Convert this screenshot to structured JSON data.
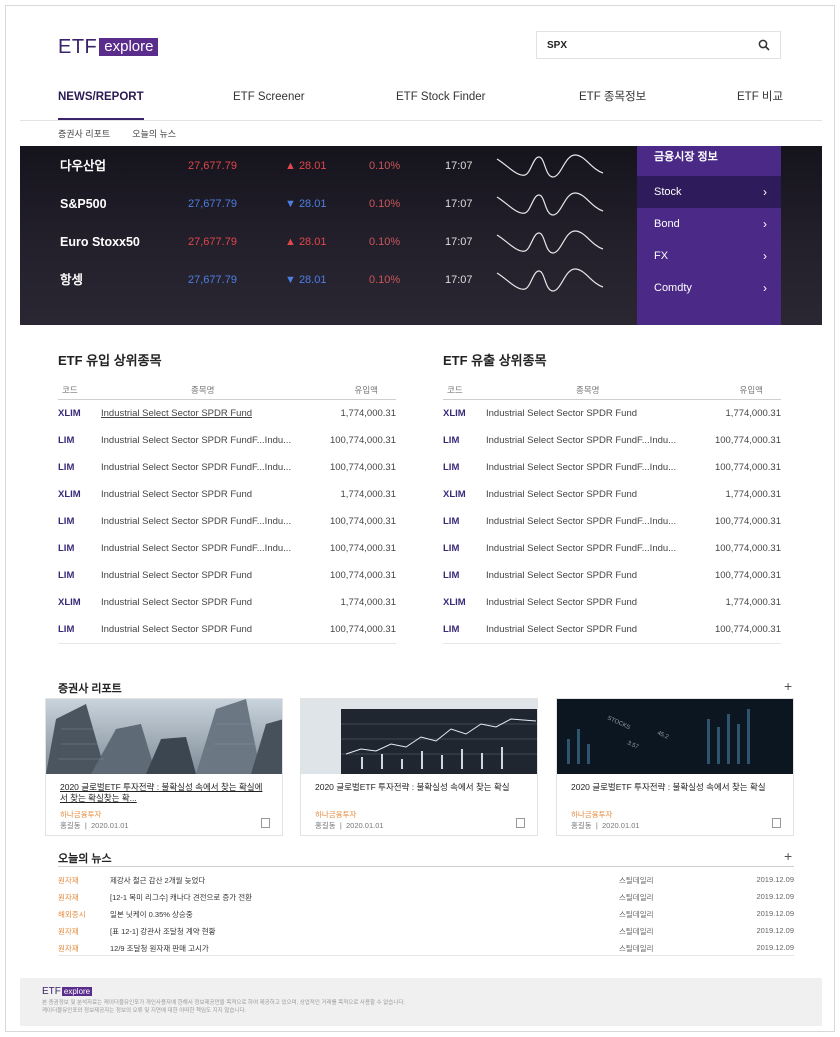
{
  "header": {
    "logo_etf": "ETF",
    "logo_explore": "explore",
    "search_value": "SPX"
  },
  "nav": {
    "tabs": [
      {
        "label": "NEWS/REPORT",
        "active": true
      },
      {
        "label": "ETF Screener"
      },
      {
        "label": "ETF Stock Finder"
      },
      {
        "label": "ETF 종목정보"
      },
      {
        "label": "ETF 비교"
      }
    ],
    "subtabs": [
      "증권사 리포트",
      "오늘의 뉴스"
    ]
  },
  "ticker": {
    "rows": [
      {
        "name": "다우산업",
        "price": "27,677.79",
        "change": "▲ 28.01",
        "pct": "0.10%",
        "time": "17:07",
        "dir": "up"
      },
      {
        "name": "S&P500",
        "price": "27,677.79",
        "change": "▼ 28.01",
        "pct": "0.10%",
        "time": "17:07",
        "dir": "down"
      },
      {
        "name": "Euro Stoxx50",
        "price": "27,677.79",
        "change": "▲ 28.01",
        "pct": "0.10%",
        "time": "17:07",
        "dir": "up"
      },
      {
        "name": "항셍",
        "price": "27,677.79",
        "change": "▼ 28.01",
        "pct": "0.10%",
        "time": "17:07",
        "dir": "down"
      }
    ],
    "market_info": {
      "title": "금융시장 정보",
      "items": [
        {
          "label": "Stock",
          "selected": true
        },
        {
          "label": "Bond"
        },
        {
          "label": "FX"
        },
        {
          "label": "Comdty"
        }
      ]
    }
  },
  "inflow": {
    "title": "ETF 유입 상위종목",
    "headers": {
      "code": "코드",
      "name": "종목명",
      "amount": "유입액"
    },
    "rows": [
      {
        "code": "XLIM",
        "name": "Industrial Select Sector SPDR Fund",
        "amount": "1,774,000.31",
        "link": true
      },
      {
        "code": "LIM",
        "name": "Industrial Select Sector SPDR FundF...Indu...",
        "amount": "100,774,000.31"
      },
      {
        "code": "LIM",
        "name": "Industrial Select Sector SPDR FundF...Indu...",
        "amount": "100,774,000.31"
      },
      {
        "code": "XLIM",
        "name": "Industrial Select Sector SPDR Fund",
        "amount": "1,774,000.31"
      },
      {
        "code": "LIM",
        "name": "Industrial Select Sector SPDR FundF...Indu...",
        "amount": "100,774,000.31"
      },
      {
        "code": "LIM",
        "name": "Industrial Select Sector SPDR FundF...Indu...",
        "amount": "100,774,000.31"
      },
      {
        "code": "LIM",
        "name": "Industrial Select Sector SPDR Fund",
        "amount": "100,774,000.31"
      },
      {
        "code": "XLIM",
        "name": "Industrial Select Sector SPDR Fund",
        "amount": "1,774,000.31"
      },
      {
        "code": "LIM",
        "name": "Industrial Select Sector SPDR Fund",
        "amount": "100,774,000.31"
      }
    ]
  },
  "outflow": {
    "title": "ETF 유출 상위종목",
    "headers": {
      "code": "코드",
      "name": "종목명",
      "amount": "유입액"
    },
    "rows": [
      {
        "code": "XLIM",
        "name": "Industrial Select Sector SPDR Fund",
        "amount": "1,774,000.31"
      },
      {
        "code": "LIM",
        "name": "Industrial Select Sector SPDR FundF...Indu...",
        "amount": "100,774,000.31"
      },
      {
        "code": "LIM",
        "name": "Industrial Select Sector SPDR FundF...Indu...",
        "amount": "100,774,000.31"
      },
      {
        "code": "XLIM",
        "name": "Industrial Select Sector SPDR Fund",
        "amount": "1,774,000.31"
      },
      {
        "code": "LIM",
        "name": "Industrial Select Sector SPDR FundF...Indu...",
        "amount": "100,774,000.31"
      },
      {
        "code": "LIM",
        "name": "Industrial Select Sector SPDR FundF...Indu...",
        "amount": "100,774,000.31"
      },
      {
        "code": "LIM",
        "name": "Industrial Select Sector SPDR Fund",
        "amount": "100,774,000.31"
      },
      {
        "code": "XLIM",
        "name": "Industrial Select Sector SPDR Fund",
        "amount": "1,774,000.31"
      },
      {
        "code": "LIM",
        "name": "Industrial Select Sector SPDR Fund",
        "amount": "100,774,000.31"
      }
    ]
  },
  "reports": {
    "title": "증권사 리포트",
    "plus": "+",
    "cards": [
      {
        "title": "2020 글로벌ETF 투자전략 : 불확실성 속에서 찾는 확실에서 찾는 확실찾는 확...",
        "publisher": "하나금융투자",
        "author": "홍길동",
        "date": "2020.01.01"
      },
      {
        "title": "2020 글로벌ETF 투자전략 : 불확실성 속에서 찾는 확실",
        "publisher": "하나금융투자",
        "author": "홍길동",
        "date": "2020.01.01"
      },
      {
        "title": "2020 글로벌ETF 투자전략 : 불확실성 속에서 찾는 확실",
        "publisher": "하나금융투자",
        "author": "홍길동",
        "date": "2020.01.01"
      }
    ]
  },
  "news": {
    "title": "오늘의 뉴스",
    "plus": "+",
    "rows": [
      {
        "category": "원자재",
        "title": "제강사 철근 감산 2개월 늦었다",
        "source": "스틸데일리",
        "date": "2019.12.09"
      },
      {
        "category": "원자재",
        "title": "[12-1 복미 리그수] 캐나다 견전으로 증가 전환",
        "source": "스틸데일리",
        "date": "2019.12.09"
      },
      {
        "category": "해외증시",
        "title": "일본 닛케이 0.35% 상승중",
        "source": "스틸데일리",
        "date": "2019.12.09"
      },
      {
        "category": "원자재",
        "title": "[표 12-1] 강관사 조달청 계약 현황",
        "source": "스틸데일리",
        "date": "2019.12.09"
      },
      {
        "category": "원자재",
        "title": "12/9 조달청 원자재 판매 고시가",
        "source": "스틸데일리",
        "date": "2019.12.09"
      }
    ]
  },
  "footer": {
    "logo_etf": "ETF",
    "logo_explore": "explore",
    "line1": "본 증권정보 및 분석자료는 케이더블유인포가 개인사용자에 한해서 정보제공만을 목적으로 하여 제공하고 있으며, 상업적인 거래를 목적으로 사용할 수 없습니다.",
    "line2": "케이더블유인포와 정보제공자는 정보의 오류 및 지연에 대한 어떠한 책임도 지지 않습니다."
  }
}
